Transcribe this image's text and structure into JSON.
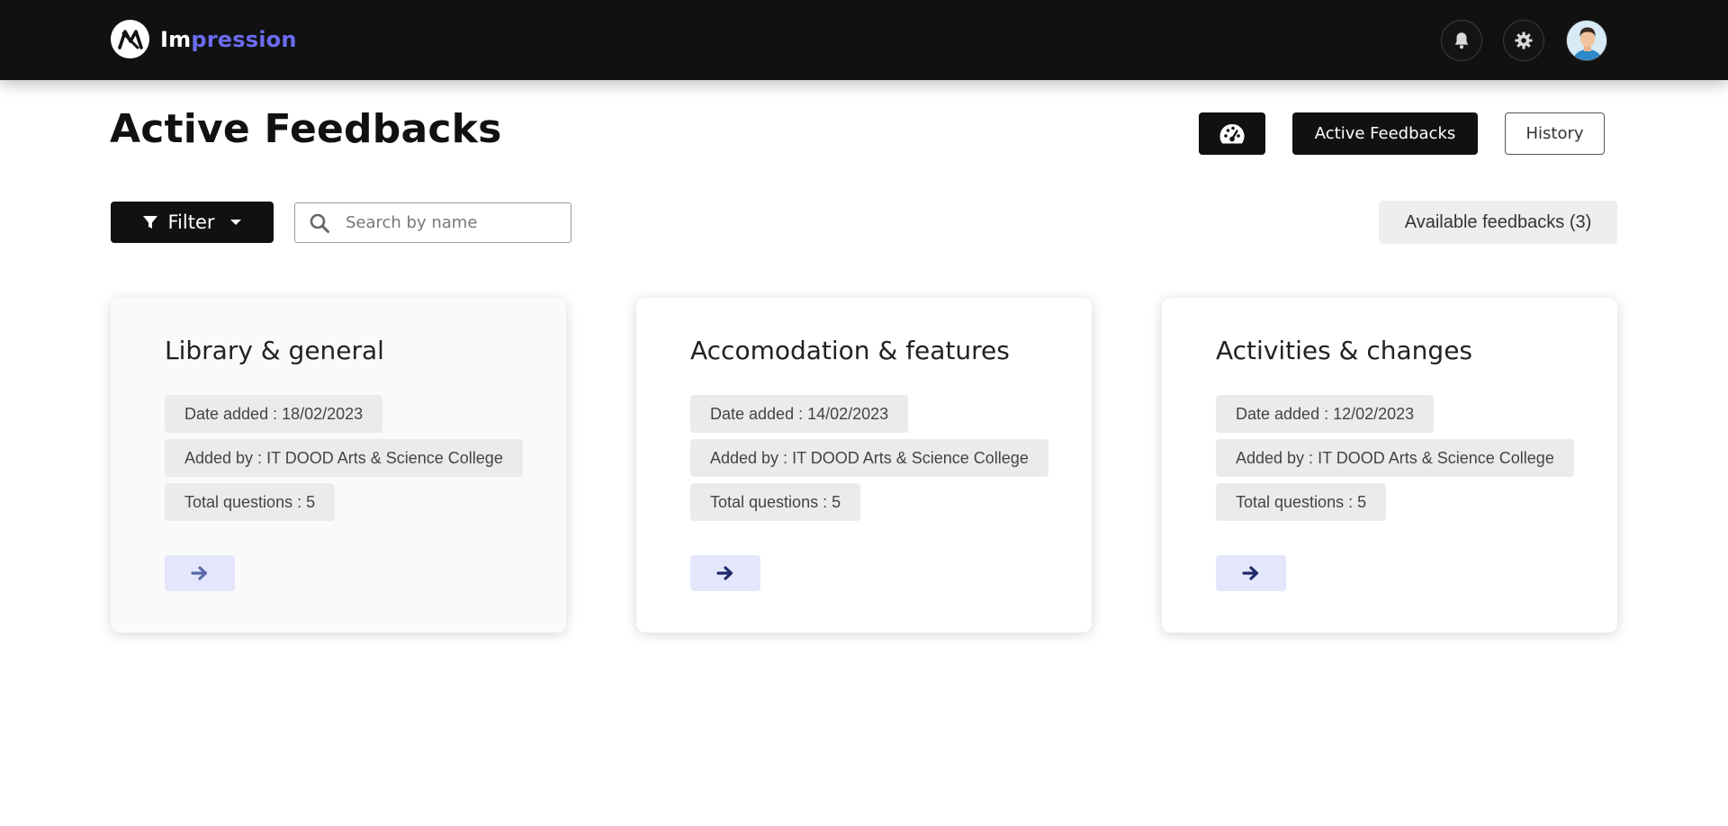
{
  "brand": {
    "name_part1": "Im",
    "name_part2": "pression"
  },
  "colors": {
    "brand_accent": "#6b6cf0",
    "topbar": "#111111",
    "chip_bg": "#ebebeb",
    "go_btn_bg": "#e4e6fb",
    "go_arrow": "#1f2a6b"
  },
  "header_icons": [
    "bell-icon",
    "gear-icon",
    "avatar"
  ],
  "page": {
    "title": "Active Feedbacks",
    "nav": {
      "dashboard_icon": "dashboard-gauge-icon",
      "active_label": "Active Feedbacks",
      "history_label": "History"
    }
  },
  "toolbar": {
    "filter_label": "Filter",
    "search_placeholder": "Search by name",
    "search_value": "",
    "available_label": "Available feedbacks (3)"
  },
  "cards": [
    {
      "title": "Library & general",
      "date": "Date added : 18/02/2023",
      "added_by": "Added by : IT DOOD Arts & Science College",
      "total": "Total questions : 5"
    },
    {
      "title": "Accomodation & features",
      "date": "Date added : 14/02/2023",
      "added_by": "Added by : IT DOOD Arts & Science College",
      "total": "Total questions : 5"
    },
    {
      "title": "Activities & changes",
      "date": "Date added : 12/02/2023",
      "added_by": "Added by : IT DOOD Arts & Science College",
      "total": "Total questions : 5"
    }
  ]
}
